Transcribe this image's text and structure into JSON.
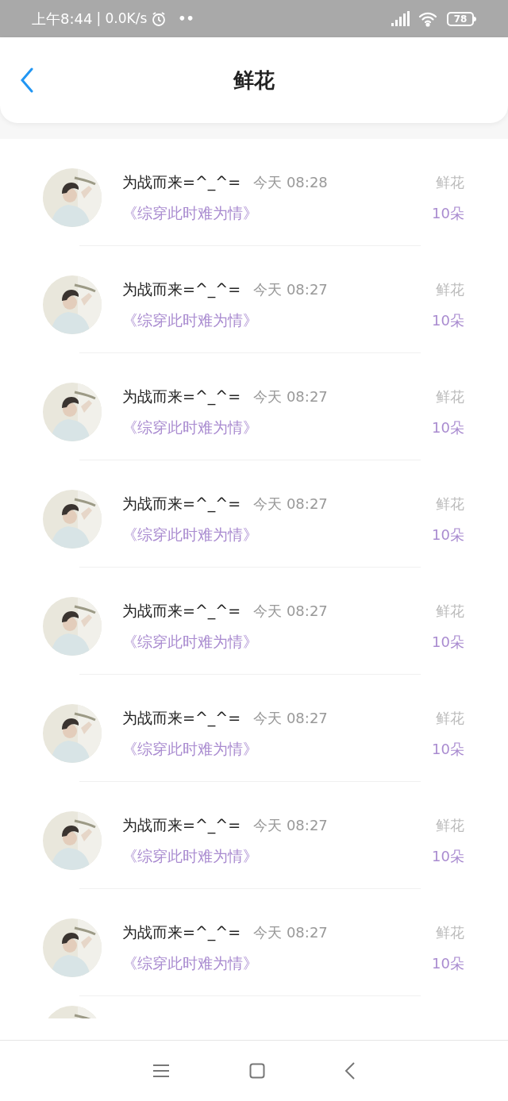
{
  "status_bar": {
    "time": "上午8:44",
    "speed": "| 0.0K/s",
    "dots": "••",
    "battery": "78"
  },
  "header": {
    "title": "鲜花"
  },
  "rows": [
    {
      "name": "为战而来=^_^=",
      "time": "今天 08:28",
      "book": "《综穿此时难为情》",
      "label": "鲜花",
      "amount": "10朵"
    },
    {
      "name": "为战而来=^_^=",
      "time": "今天 08:27",
      "book": "《综穿此时难为情》",
      "label": "鲜花",
      "amount": "10朵"
    },
    {
      "name": "为战而来=^_^=",
      "time": "今天 08:27",
      "book": "《综穿此时难为情》",
      "label": "鲜花",
      "amount": "10朵"
    },
    {
      "name": "为战而来=^_^=",
      "time": "今天 08:27",
      "book": "《综穿此时难为情》",
      "label": "鲜花",
      "amount": "10朵"
    },
    {
      "name": "为战而来=^_^=",
      "time": "今天 08:27",
      "book": "《综穿此时难为情》",
      "label": "鲜花",
      "amount": "10朵"
    },
    {
      "name": "为战而来=^_^=",
      "time": "今天 08:27",
      "book": "《综穿此时难为情》",
      "label": "鲜花",
      "amount": "10朵"
    },
    {
      "name": "为战而来=^_^=",
      "time": "今天 08:27",
      "book": "《综穿此时难为情》",
      "label": "鲜花",
      "amount": "10朵"
    },
    {
      "name": "为战而来=^_^=",
      "time": "今天 08:27",
      "book": "《综穿此时难为情》",
      "label": "鲜花",
      "amount": "10朵"
    }
  ]
}
